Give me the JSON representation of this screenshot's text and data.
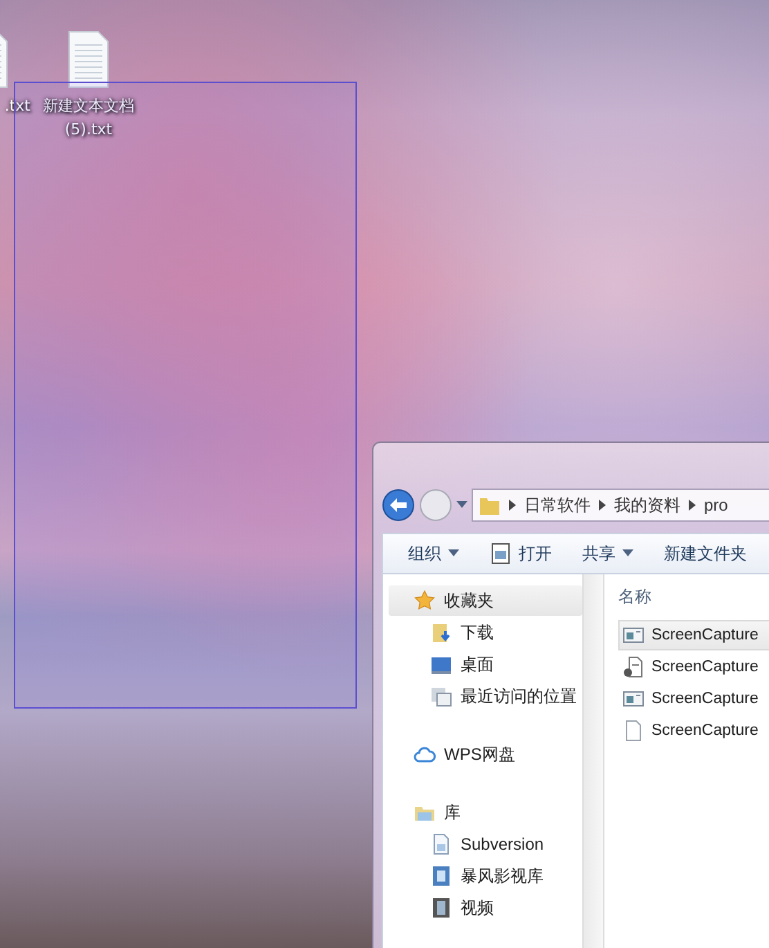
{
  "desktop": {
    "icons": [
      {
        "label": ".txt"
      },
      {
        "label": "新建文本文档 (5).txt"
      }
    ]
  },
  "explorer": {
    "address_path": [
      "日常软件",
      "我的资料",
      "pro"
    ],
    "toolbar": [
      {
        "label": "组织",
        "kind": "menu"
      },
      {
        "label": "打开",
        "kind": "open"
      },
      {
        "label": "共享",
        "kind": "menu"
      },
      {
        "label": "新建文件夹",
        "kind": "plain"
      }
    ],
    "nav": [
      {
        "label": "收藏夹",
        "kind": "star",
        "selected": true,
        "children": [
          {
            "label": "下载",
            "kind": "download"
          },
          {
            "label": "桌面",
            "kind": "desktop"
          },
          {
            "label": "最近访问的位置",
            "kind": "recent"
          }
        ]
      },
      {
        "label": "WPS网盘",
        "kind": "cloud",
        "selected": false
      },
      {
        "label": "库",
        "kind": "library",
        "selected": false,
        "children": [
          {
            "label": "Subversion",
            "kind": "doc"
          },
          {
            "label": "暴风影视库",
            "kind": "video"
          },
          {
            "label": "视频",
            "kind": "film"
          }
        ]
      }
    ],
    "column_header": "名称",
    "files": [
      {
        "name": "ScreenCapture",
        "kind": "window",
        "selected": true
      },
      {
        "name": "ScreenCapture",
        "kind": "script",
        "selected": false
      },
      {
        "name": "ScreenCapture",
        "kind": "window",
        "selected": false
      },
      {
        "name": "ScreenCapture",
        "kind": "blank",
        "selected": false
      }
    ]
  }
}
